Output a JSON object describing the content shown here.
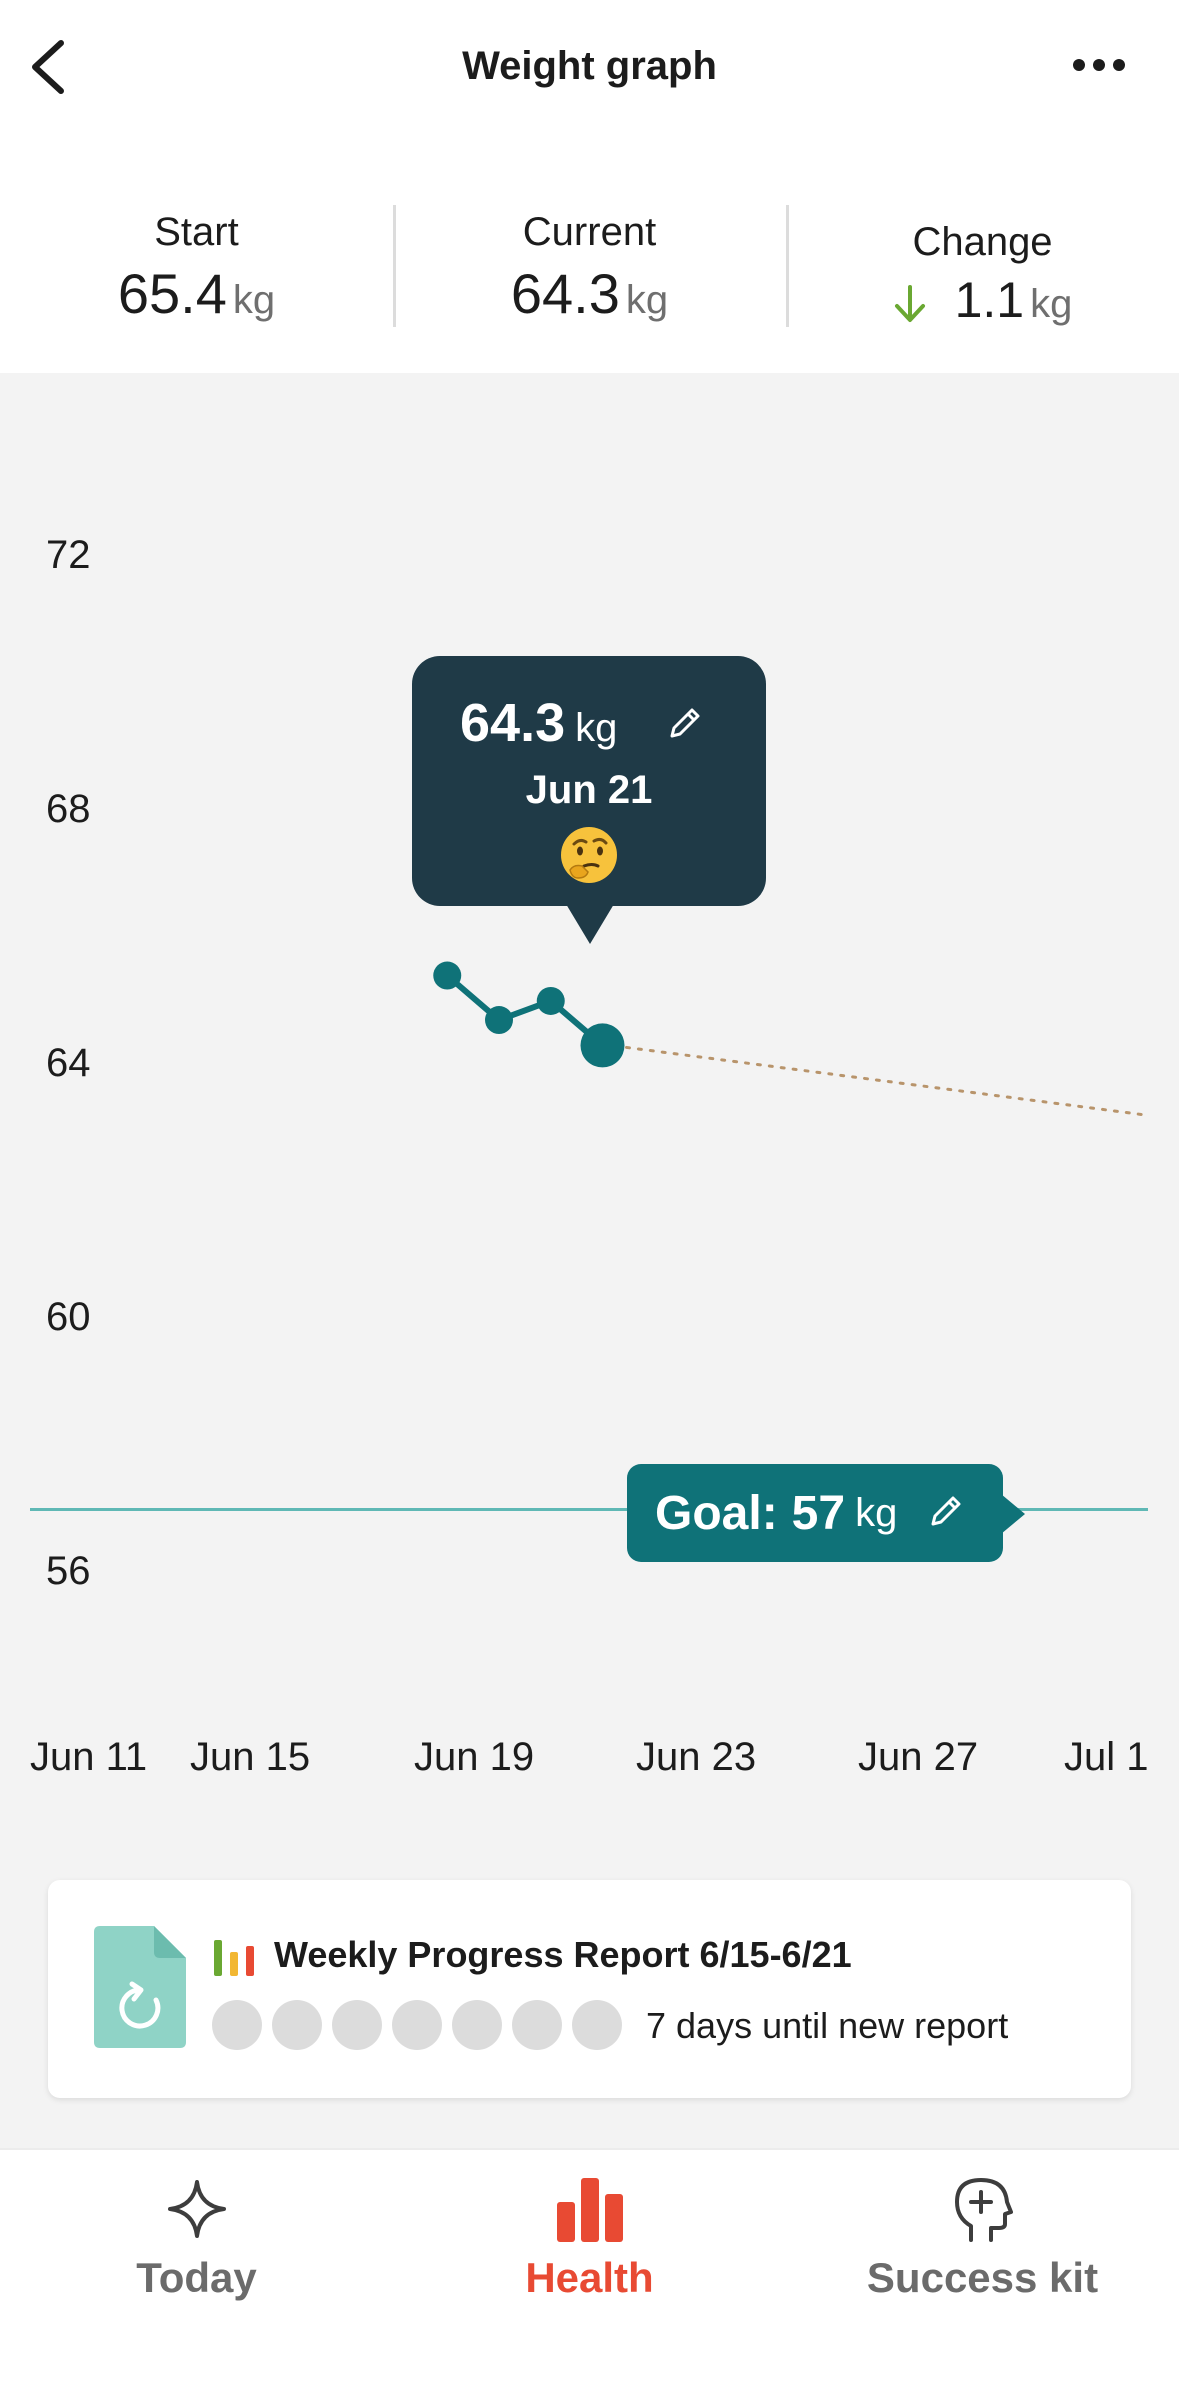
{
  "header": {
    "title": "Weight graph",
    "back_icon": "chevron-left-icon",
    "more_icon": "more-horizontal-icon"
  },
  "stats": {
    "start": {
      "label": "Start",
      "value": "65.4",
      "unit": "kg"
    },
    "current": {
      "label": "Current",
      "value": "64.3",
      "unit": "kg"
    },
    "change": {
      "label": "Change",
      "value": "1.1",
      "unit": "kg",
      "direction": "down",
      "direction_color": "#6aa832"
    }
  },
  "tooltip": {
    "value": "64.3",
    "unit": "kg",
    "date": "Jun 21",
    "emoji": "thinking-face",
    "background": "#1f3a47"
  },
  "goal": {
    "label": "Goal:",
    "value": "57",
    "unit": "kg",
    "color": "#0f7278"
  },
  "chart_data": {
    "type": "line",
    "y_ticks": [
      "72",
      "68",
      "64",
      "60",
      "56"
    ],
    "x_ticks": [
      "Jun 11",
      "Jun 15",
      "Jun 19",
      "Jun 23",
      "Jun 27",
      "Jul 1"
    ],
    "ylim": [
      54,
      74
    ],
    "series": [
      {
        "x": [
          "Jun 18",
          "Jun 19",
          "Jun 20",
          "Jun 21"
        ],
        "y": [
          65.4,
          64.7,
          65.0,
          64.3
        ],
        "color": "#0f7278"
      }
    ],
    "projection": {
      "x": [
        "Jun 21",
        "Jul 1"
      ],
      "y": [
        64.3,
        63.2
      ],
      "style": "dotted",
      "color": "#b8946b"
    },
    "goal_line": {
      "y": 57,
      "color": "#5fb8b5"
    },
    "grid": false
  },
  "report": {
    "title": "Weekly Progress Report 6/15-6/21",
    "subtitle": "7 days until new report",
    "days": 7,
    "doc_color": "#8fd3c6",
    "bar_colors": [
      "#6aa832",
      "#f2b732",
      "#e84a33"
    ]
  },
  "nav": {
    "items": [
      {
        "label": "Today",
        "icon": "sparkle-icon",
        "active": false
      },
      {
        "label": "Health",
        "icon": "bar-chart-icon",
        "active": true
      },
      {
        "label": "Success kit",
        "icon": "head-plus-icon",
        "active": false
      }
    ],
    "active_color": "#e84a33"
  }
}
